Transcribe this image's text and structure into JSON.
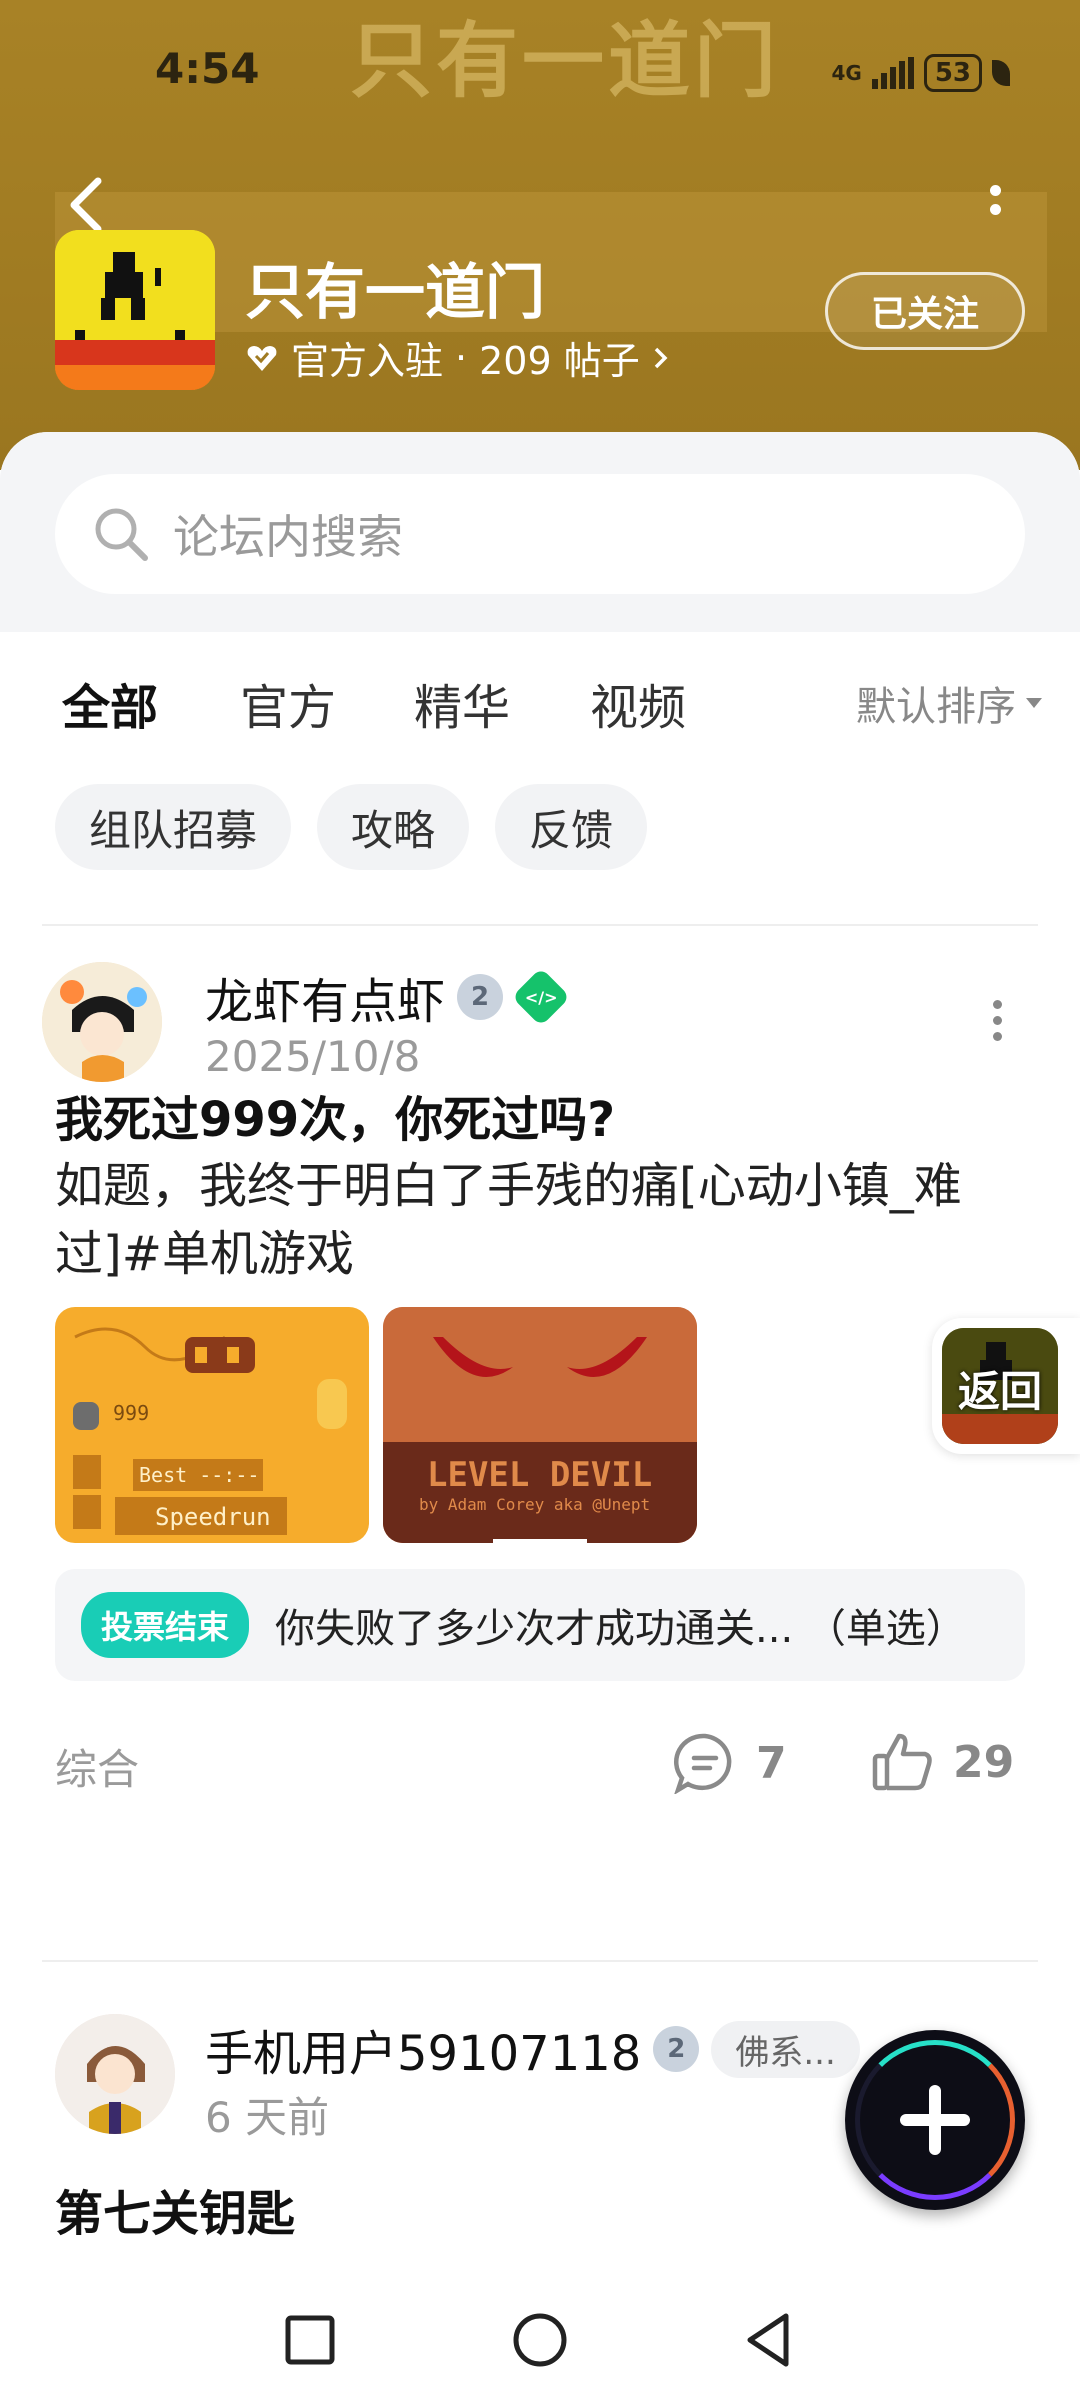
{
  "status_bar": {
    "time": "4:54",
    "network": "4G",
    "battery": "53"
  },
  "header": {
    "watermark": "只有一道门",
    "title": "只有一道门",
    "official_label": "官方入驻",
    "separator": "·",
    "posts_count": "209 帖子",
    "follow_label": "已关注"
  },
  "search": {
    "placeholder": "论坛内搜索"
  },
  "tabs": [
    {
      "label": "全部",
      "active": true
    },
    {
      "label": "官方",
      "active": false
    },
    {
      "label": "精华",
      "active": false
    },
    {
      "label": "视频",
      "active": false
    }
  ],
  "sort_label": "默认排序",
  "chips": [
    "组队招募",
    "攻略",
    "反馈"
  ],
  "posts": [
    {
      "author": "龙虾有点虾",
      "badge_level": "2",
      "date": "2025/10/8",
      "title": "我死过999次，你死过吗?",
      "body": "如题，我终于明白了手残的痛[心动小镇_难过]#单机游戏",
      "thumb1": {
        "count": "999",
        "best": "Best --:--",
        "speedrun": "Speedrun"
      },
      "thumb2": {
        "title": "LEVEL DEVIL",
        "credit": "by Adam Corey aka @Unept"
      },
      "vote": {
        "tag": "投票结束",
        "text": "你失败了多少次才成功通关... （单选）"
      },
      "category": "综合",
      "comments": "7",
      "likes": "29"
    },
    {
      "author": "手机用户59107118",
      "badge_level": "2",
      "tag": "佛系...",
      "date": "6 天前",
      "title": "第七关钥匙"
    }
  ],
  "return_float": {
    "label": "返回"
  },
  "colors": {
    "accent": "#1ccdb8",
    "header_bg": "#a07b22",
    "vote_tag": "#19cdb6"
  }
}
